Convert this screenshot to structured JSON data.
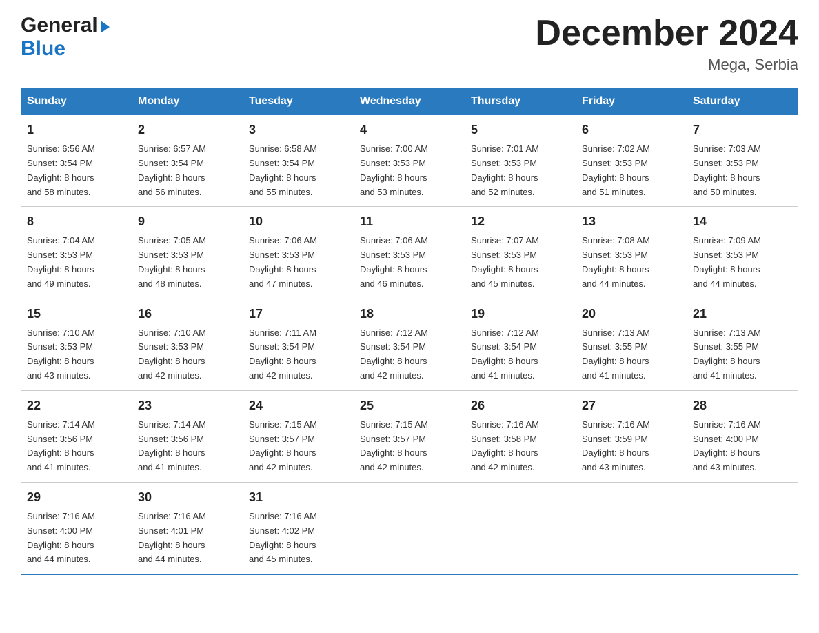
{
  "header": {
    "logo_general": "General",
    "logo_blue": "Blue",
    "month_title": "December 2024",
    "location": "Mega, Serbia"
  },
  "days_of_week": [
    "Sunday",
    "Monday",
    "Tuesday",
    "Wednesday",
    "Thursday",
    "Friday",
    "Saturday"
  ],
  "weeks": [
    [
      {
        "day": "1",
        "sunrise": "Sunrise: 6:56 AM",
        "sunset": "Sunset: 3:54 PM",
        "daylight": "Daylight: 8 hours and 58 minutes."
      },
      {
        "day": "2",
        "sunrise": "Sunrise: 6:57 AM",
        "sunset": "Sunset: 3:54 PM",
        "daylight": "Daylight: 8 hours and 56 minutes."
      },
      {
        "day": "3",
        "sunrise": "Sunrise: 6:58 AM",
        "sunset": "Sunset: 3:54 PM",
        "daylight": "Daylight: 8 hours and 55 minutes."
      },
      {
        "day": "4",
        "sunrise": "Sunrise: 7:00 AM",
        "sunset": "Sunset: 3:53 PM",
        "daylight": "Daylight: 8 hours and 53 minutes."
      },
      {
        "day": "5",
        "sunrise": "Sunrise: 7:01 AM",
        "sunset": "Sunset: 3:53 PM",
        "daylight": "Daylight: 8 hours and 52 minutes."
      },
      {
        "day": "6",
        "sunrise": "Sunrise: 7:02 AM",
        "sunset": "Sunset: 3:53 PM",
        "daylight": "Daylight: 8 hours and 51 minutes."
      },
      {
        "day": "7",
        "sunrise": "Sunrise: 7:03 AM",
        "sunset": "Sunset: 3:53 PM",
        "daylight": "Daylight: 8 hours and 50 minutes."
      }
    ],
    [
      {
        "day": "8",
        "sunrise": "Sunrise: 7:04 AM",
        "sunset": "Sunset: 3:53 PM",
        "daylight": "Daylight: 8 hours and 49 minutes."
      },
      {
        "day": "9",
        "sunrise": "Sunrise: 7:05 AM",
        "sunset": "Sunset: 3:53 PM",
        "daylight": "Daylight: 8 hours and 48 minutes."
      },
      {
        "day": "10",
        "sunrise": "Sunrise: 7:06 AM",
        "sunset": "Sunset: 3:53 PM",
        "daylight": "Daylight: 8 hours and 47 minutes."
      },
      {
        "day": "11",
        "sunrise": "Sunrise: 7:06 AM",
        "sunset": "Sunset: 3:53 PM",
        "daylight": "Daylight: 8 hours and 46 minutes."
      },
      {
        "day": "12",
        "sunrise": "Sunrise: 7:07 AM",
        "sunset": "Sunset: 3:53 PM",
        "daylight": "Daylight: 8 hours and 45 minutes."
      },
      {
        "day": "13",
        "sunrise": "Sunrise: 7:08 AM",
        "sunset": "Sunset: 3:53 PM",
        "daylight": "Daylight: 8 hours and 44 minutes."
      },
      {
        "day": "14",
        "sunrise": "Sunrise: 7:09 AM",
        "sunset": "Sunset: 3:53 PM",
        "daylight": "Daylight: 8 hours and 44 minutes."
      }
    ],
    [
      {
        "day": "15",
        "sunrise": "Sunrise: 7:10 AM",
        "sunset": "Sunset: 3:53 PM",
        "daylight": "Daylight: 8 hours and 43 minutes."
      },
      {
        "day": "16",
        "sunrise": "Sunrise: 7:10 AM",
        "sunset": "Sunset: 3:53 PM",
        "daylight": "Daylight: 8 hours and 42 minutes."
      },
      {
        "day": "17",
        "sunrise": "Sunrise: 7:11 AM",
        "sunset": "Sunset: 3:54 PM",
        "daylight": "Daylight: 8 hours and 42 minutes."
      },
      {
        "day": "18",
        "sunrise": "Sunrise: 7:12 AM",
        "sunset": "Sunset: 3:54 PM",
        "daylight": "Daylight: 8 hours and 42 minutes."
      },
      {
        "day": "19",
        "sunrise": "Sunrise: 7:12 AM",
        "sunset": "Sunset: 3:54 PM",
        "daylight": "Daylight: 8 hours and 41 minutes."
      },
      {
        "day": "20",
        "sunrise": "Sunrise: 7:13 AM",
        "sunset": "Sunset: 3:55 PM",
        "daylight": "Daylight: 8 hours and 41 minutes."
      },
      {
        "day": "21",
        "sunrise": "Sunrise: 7:13 AM",
        "sunset": "Sunset: 3:55 PM",
        "daylight": "Daylight: 8 hours and 41 minutes."
      }
    ],
    [
      {
        "day": "22",
        "sunrise": "Sunrise: 7:14 AM",
        "sunset": "Sunset: 3:56 PM",
        "daylight": "Daylight: 8 hours and 41 minutes."
      },
      {
        "day": "23",
        "sunrise": "Sunrise: 7:14 AM",
        "sunset": "Sunset: 3:56 PM",
        "daylight": "Daylight: 8 hours and 41 minutes."
      },
      {
        "day": "24",
        "sunrise": "Sunrise: 7:15 AM",
        "sunset": "Sunset: 3:57 PM",
        "daylight": "Daylight: 8 hours and 42 minutes."
      },
      {
        "day": "25",
        "sunrise": "Sunrise: 7:15 AM",
        "sunset": "Sunset: 3:57 PM",
        "daylight": "Daylight: 8 hours and 42 minutes."
      },
      {
        "day": "26",
        "sunrise": "Sunrise: 7:16 AM",
        "sunset": "Sunset: 3:58 PM",
        "daylight": "Daylight: 8 hours and 42 minutes."
      },
      {
        "day": "27",
        "sunrise": "Sunrise: 7:16 AM",
        "sunset": "Sunset: 3:59 PM",
        "daylight": "Daylight: 8 hours and 43 minutes."
      },
      {
        "day": "28",
        "sunrise": "Sunrise: 7:16 AM",
        "sunset": "Sunset: 4:00 PM",
        "daylight": "Daylight: 8 hours and 43 minutes."
      }
    ],
    [
      {
        "day": "29",
        "sunrise": "Sunrise: 7:16 AM",
        "sunset": "Sunset: 4:00 PM",
        "daylight": "Daylight: 8 hours and 44 minutes."
      },
      {
        "day": "30",
        "sunrise": "Sunrise: 7:16 AM",
        "sunset": "Sunset: 4:01 PM",
        "daylight": "Daylight: 8 hours and 44 minutes."
      },
      {
        "day": "31",
        "sunrise": "Sunrise: 7:16 AM",
        "sunset": "Sunset: 4:02 PM",
        "daylight": "Daylight: 8 hours and 45 minutes."
      },
      null,
      null,
      null,
      null
    ]
  ]
}
